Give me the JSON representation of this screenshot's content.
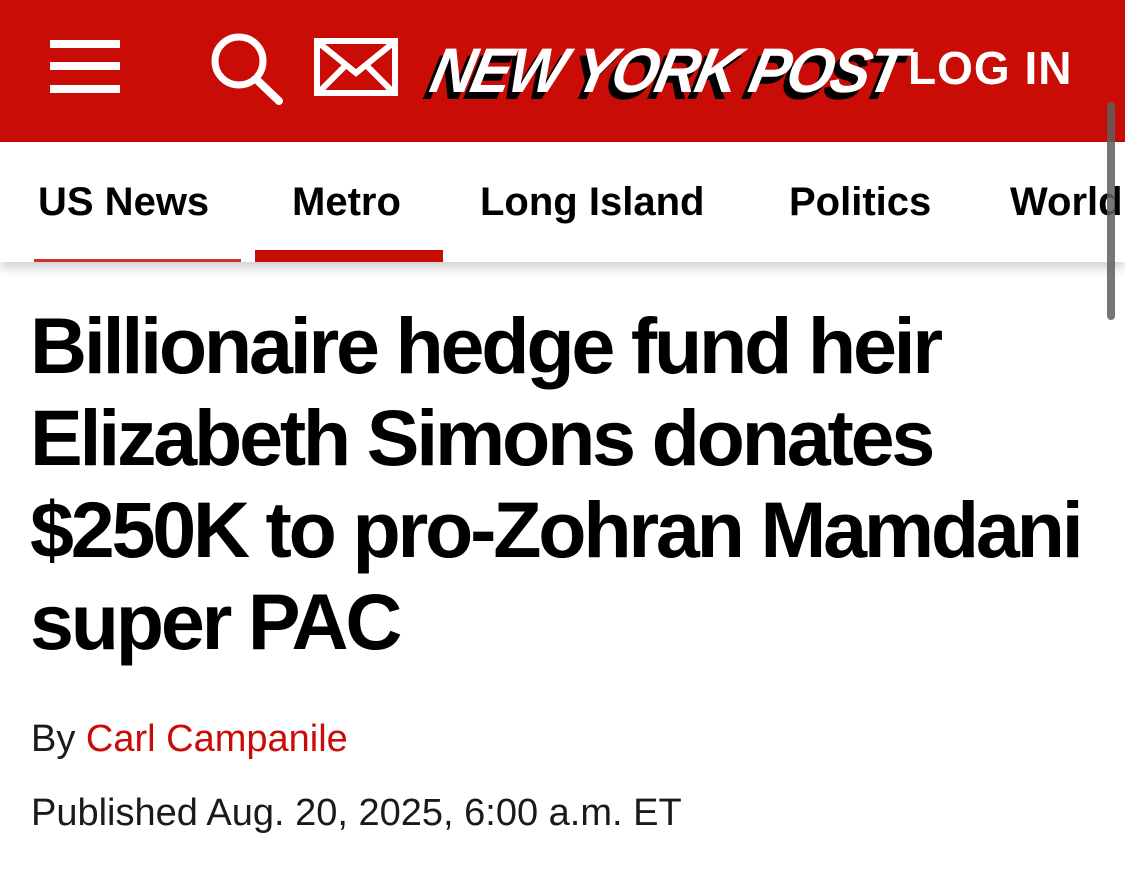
{
  "header": {
    "background_color": "#c90c06",
    "menu_icon": "hamburger-menu-icon",
    "search_icon": "search-icon",
    "mail_icon": "mail-icon",
    "logo_text": "NEW YORK POST",
    "login_label": "LOG IN"
  },
  "nav": {
    "items": [
      {
        "label": "US News"
      },
      {
        "label": "Metro",
        "active": true
      },
      {
        "label": "Long Island"
      },
      {
        "label": "Politics"
      },
      {
        "label": "World"
      }
    ],
    "accent_color": "#c90c06"
  },
  "article": {
    "headline": "Billionaire hedge fund heir Elizabeth Simons donates $250K to pro-Zohran Mamdani super PAC",
    "byline_prefix": "By",
    "author": "Carl Campanile",
    "published": "Published Aug. 20, 2025, 6:00 a.m. ET"
  }
}
